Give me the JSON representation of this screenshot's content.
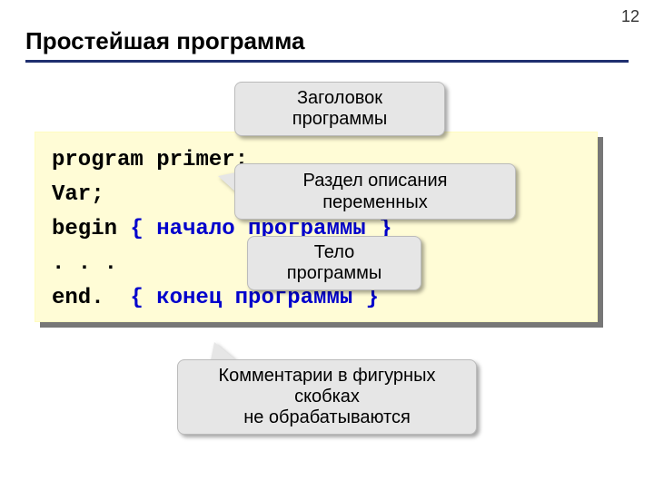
{
  "page_number": "12",
  "title": "Простейшая программа",
  "code": {
    "l1_kw": "program",
    "l1_rest": " primer;",
    "l2": "Var;",
    "l3_kw": "begin",
    "l3_cmt": " { начало программы }",
    "l4": ". . .",
    "l5_kw": "end.",
    "l5_sp": "  ",
    "l5_cmt": "{ конец программы }"
  },
  "callouts": {
    "header": "Заголовок программы",
    "vardecl": "Раздел описания переменных",
    "body": "Тело программы",
    "comments_l1": "Комментарии в фигурных скобках",
    "comments_l2": "не обрабатываются"
  }
}
